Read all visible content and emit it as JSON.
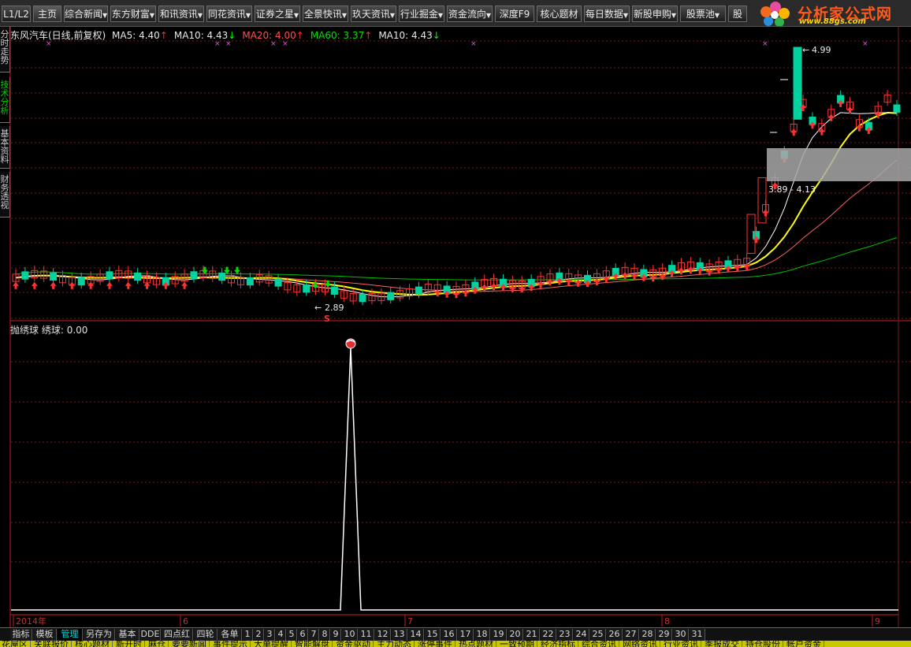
{
  "toolbar": {
    "buttons": [
      {
        "label": "L1/L2",
        "dropdown": false
      },
      {
        "label": "主页",
        "dropdown": false
      },
      {
        "label": "综合新闻",
        "dropdown": true
      },
      {
        "label": "东方财富",
        "dropdown": true
      },
      {
        "label": "和讯资讯",
        "dropdown": true
      },
      {
        "label": "同花资讯",
        "dropdown": true
      },
      {
        "label": "证券之星",
        "dropdown": true
      },
      {
        "label": "全景快讯",
        "dropdown": true
      },
      {
        "label": "玖天资讯",
        "dropdown": true
      },
      {
        "label": "行业掘金",
        "dropdown": true
      },
      {
        "label": "资金流向",
        "dropdown": true
      },
      {
        "label": "深度F9",
        "dropdown": false
      },
      {
        "label": "核心题材",
        "dropdown": false
      },
      {
        "label": "每日数据",
        "dropdown": true
      },
      {
        "label": "新股申购",
        "dropdown": true
      },
      {
        "label": "股票池",
        "dropdown": true
      },
      {
        "label": "股",
        "dropdown": false
      }
    ],
    "logo": {
      "title": "分析家公式网",
      "url": "www.88gs.com"
    }
  },
  "side_tabs": [
    {
      "label": "分时走势",
      "active": false
    },
    {
      "label": "技术分析",
      "active": true
    },
    {
      "label": "基本资料",
      "active": false
    },
    {
      "label": "财务透视",
      "active": false
    }
  ],
  "main_legend": {
    "title": "东风汽车(日线,前复权)",
    "items": [
      {
        "text": "MA5: 4.40",
        "arrow": "↑",
        "color": "#e8e8e8",
        "arrow_color": "#ff3030"
      },
      {
        "text": "MA10: 4.43",
        "arrow": "↓",
        "color": "#e8e8e8",
        "arrow_color": "#00ff00"
      },
      {
        "text": "MA20: 4.00",
        "arrow": "↑",
        "color": "#ff5050",
        "arrow_color": "#ff3030"
      },
      {
        "text": "MA60: 3.37",
        "arrow": "↑",
        "color": "#00e000",
        "arrow_color": "#ff3030"
      },
      {
        "text": "MA10: 4.43",
        "arrow": "↓",
        "color": "#e8e8e8",
        "arrow_color": "#00ff00"
      }
    ]
  },
  "price_labels": {
    "high": "4.99",
    "low": "2.89",
    "range": "3.89 - 4.13",
    "signal": "S"
  },
  "sub_legend": {
    "name": "抛绣球",
    "label": "绣球: 0.00"
  },
  "x_axis": [
    "2014年",
    "6",
    "7",
    "8",
    "9"
  ],
  "bottom_tabs": {
    "tools": [
      "指标",
      "模板",
      "管理",
      "另存为",
      "基本",
      "DDE",
      "四点红",
      "四轮",
      "各单"
    ],
    "selected": "管理",
    "days": [
      "1",
      "2",
      "3",
      "4",
      "5",
      "6",
      "7",
      "8",
      "9",
      "10",
      "11",
      "12",
      "13",
      "14",
      "15",
      "16",
      "17",
      "18",
      "19",
      "20",
      "21",
      "22",
      "23",
      "24",
      "25",
      "26",
      "27",
      "28",
      "29",
      "30",
      "31"
    ]
  },
  "status_bar": [
    "花屋区",
    "关联报价",
    "核心题材",
    "新开时",
    "麻仓",
    "要要新闻",
    "事件提示",
    "大单提醒",
    "智能解盘",
    "资金驱动",
    "主力动态",
    "涨停事件",
    "热点题材",
    "一致预期",
    "经济指标",
    "综合资讯",
    "网络资讯",
    "行业资讯",
    "季报成交",
    "持仓股份",
    "帐户资金"
  ],
  "colors": {
    "up": "#ff3232",
    "down": "#00d2a0",
    "ma5": "#ffffff",
    "ma10": "#ffff00",
    "ma20": "#ff6060",
    "ma60": "#00c000",
    "grid": "#7a1a1a",
    "signal": "#ffffff"
  }
}
